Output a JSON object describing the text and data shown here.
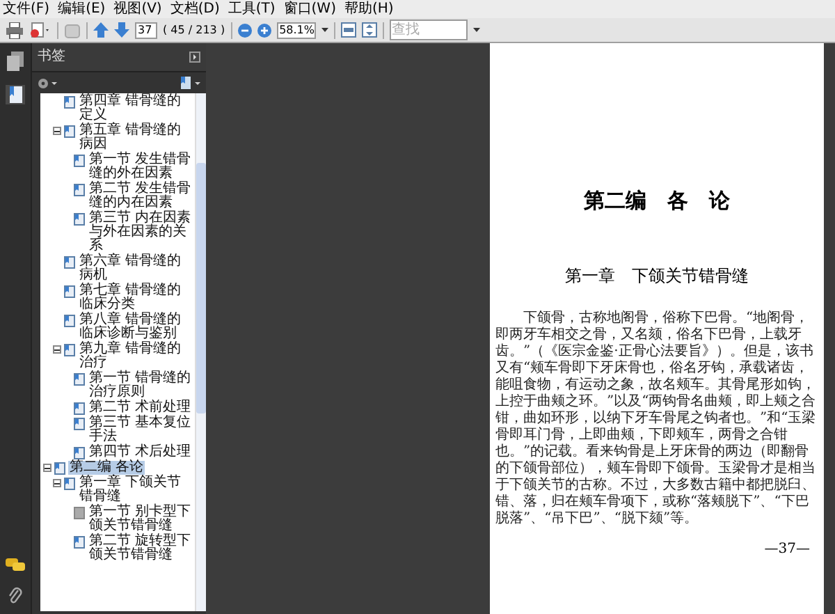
{
  "menu": [
    "文件(F)",
    "编辑(E)",
    "视图(V)",
    "文档(D)",
    "工具(T)",
    "窗口(W)",
    "帮助(H)"
  ],
  "toolbar": {
    "page": "37",
    "page_count": "( 45 / 213 )",
    "zoom": "58.1%",
    "search": {
      "placeholder": "查找"
    }
  },
  "bookmarks_panel": {
    "title": "书签",
    "items": [
      {
        "kind": "chapter",
        "label": "第四章 错骨缝的定义",
        "selected": false
      },
      {
        "kind": "chapter",
        "label": "第五章 错骨缝的病因",
        "selected": false,
        "expanded": true,
        "children": [
          {
            "kind": "section",
            "label": "第一节 发生错骨缝的外在因素",
            "selected": false
          },
          {
            "kind": "section",
            "label": "第二节 发生错骨缝的内在因素",
            "selected": false
          },
          {
            "kind": "section",
            "label": "第三节 内在因素与外在因素的关系",
            "selected": false
          }
        ]
      },
      {
        "kind": "chapter",
        "label": "第六章 错骨缝的病机",
        "selected": false
      },
      {
        "kind": "chapter",
        "label": "第七章 错骨缝的临床分类",
        "selected": false
      },
      {
        "kind": "chapter",
        "label": "第八章 错骨缝的临床诊断与鉴别",
        "selected": false
      },
      {
        "kind": "chapter",
        "label": "第九章 错骨缝的治疗",
        "selected": false,
        "expanded": true,
        "children": [
          {
            "kind": "section",
            "label": "第一节 错骨缝的治疗原则",
            "selected": false
          },
          {
            "kind": "section",
            "label": "第二节 术前处理",
            "selected": false
          },
          {
            "kind": "section",
            "label": "第三节 基本复位手法",
            "selected": false
          },
          {
            "kind": "section",
            "label": "第四节 术后处理",
            "selected": false
          }
        ]
      },
      {
        "kind": "part",
        "label": "第二编 各论",
        "selected": true,
        "expanded": true,
        "children": [
          {
            "kind": "chapter",
            "label": "第一章 下颌关节错骨缝",
            "selected": false,
            "expanded": true,
            "children": [
              {
                "kind": "section",
                "label": "第一节 别卡型下颌关节错骨缝",
                "selected": false,
                "disabled": true
              },
              {
                "kind": "section",
                "label": "第二节 旋转型下颌关节错骨缝",
                "selected": false,
                "disabled": false
              }
            ]
          }
        ]
      }
    ]
  },
  "document_page": {
    "part_title": "第二编　各　论",
    "chapter_title": "第一章　下颌关节错骨缝",
    "paragraph": "下颌骨，古称地阁骨，俗称下巴骨。“地阁骨，即两牙车相交之骨，又名颏，俗名下巴骨，上载牙齿。”（《医宗金鉴·正骨心法要旨》）。但是，该书又有“颊车骨即下牙床骨也，俗名牙钩，承载诸齿，能咀食物，有运动之象，故名颊车。其骨尾形如钩，上控于曲颊之环。”以及“两钩骨名曲颊，即上颊之合钳，曲如环形，以纳下牙车骨尾之钩者也。”和“玉梁骨即耳门骨，上即曲颊，下即颊车，两骨之合钳也。”的记载。看来钩骨是上牙床骨的两边（即翻骨的下颌骨部位），颊车骨即下颌骨。玉梁骨才是相当于下颌关节的古称。不过，大多数古籍中都把脱臼、错、落，归在颊车骨项下，或称“落颊脱下”、“下巴脱落”、“吊下巴”、“脱下颏”等。",
    "page_number": "—37—"
  }
}
